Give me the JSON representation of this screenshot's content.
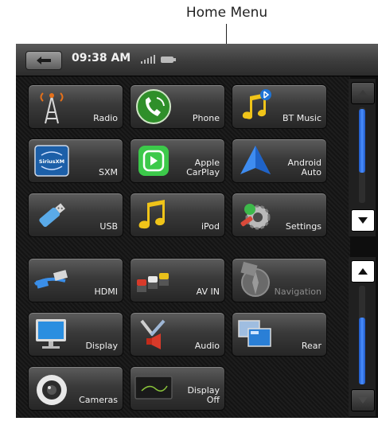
{
  "callout": {
    "label": "Home Menu"
  },
  "status": {
    "time": "09:38 AM"
  },
  "tiles_top": [
    {
      "name": "radio",
      "label": "Radio"
    },
    {
      "name": "phone",
      "label": "Phone"
    },
    {
      "name": "bt-music",
      "label": "BT Music"
    },
    {
      "name": "sxm",
      "label": "SXM",
      "icon_text": "SiriusXM"
    },
    {
      "name": "apple-carplay",
      "label": "Apple\nCarPlay"
    },
    {
      "name": "android-auto",
      "label": "Android\nAuto"
    },
    {
      "name": "usb",
      "label": "USB"
    },
    {
      "name": "ipod",
      "label": "iPod"
    },
    {
      "name": "settings",
      "label": "Settings"
    }
  ],
  "tiles_bottom": [
    {
      "name": "hdmi",
      "label": "HDMI"
    },
    {
      "name": "av-in",
      "label": "AV IN"
    },
    {
      "name": "navigation",
      "label": "Navigation",
      "disabled": true
    },
    {
      "name": "display",
      "label": "Display"
    },
    {
      "name": "audio",
      "label": "Audio"
    },
    {
      "name": "rear",
      "label": "Rear"
    },
    {
      "name": "cameras",
      "label": "Cameras"
    },
    {
      "name": "display-off",
      "label": "Display\nOff"
    }
  ],
  "colors": {
    "accent_blue": "#3a7cff",
    "background": "#0e0e0e"
  }
}
